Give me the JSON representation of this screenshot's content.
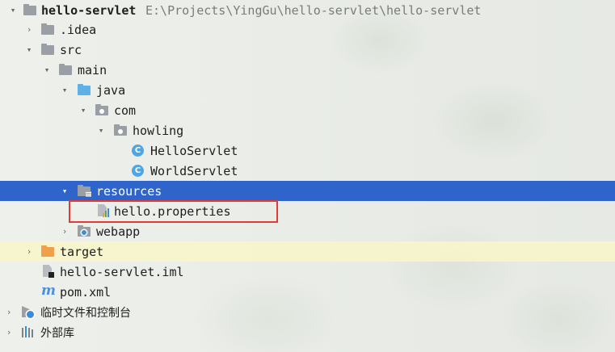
{
  "project_tree": {
    "root": {
      "name": "hello-servlet",
      "path": "E:\\Projects\\YingGu\\hello-servlet\\hello-servlet",
      "icon": "folder-icon"
    },
    "items": [
      {
        "label": ".idea",
        "icon": "folder-icon",
        "expanded": false
      },
      {
        "label": "src",
        "icon": "folder-icon",
        "expanded": true
      },
      {
        "label": "main",
        "icon": "folder-icon",
        "expanded": true
      },
      {
        "label": "java",
        "icon": "source-folder-icon",
        "expanded": true
      },
      {
        "label": "com",
        "icon": "package-icon",
        "expanded": true
      },
      {
        "label": "howling",
        "icon": "package-icon",
        "expanded": true
      },
      {
        "label": "HelloServlet",
        "icon": "class-icon"
      },
      {
        "label": "WorldServlet",
        "icon": "class-icon"
      },
      {
        "label": "resources",
        "icon": "resources-folder-icon",
        "expanded": true,
        "selected": true
      },
      {
        "label": "hello.properties",
        "icon": "properties-file-icon",
        "highlighted": true
      },
      {
        "label": "webapp",
        "icon": "web-folder-icon",
        "expanded": false
      },
      {
        "label": "target",
        "icon": "excluded-folder-icon",
        "expanded": false
      },
      {
        "label": "hello-servlet.iml",
        "icon": "iml-file-icon"
      },
      {
        "label": "pom.xml",
        "icon": "maven-icon"
      },
      {
        "label": "临时文件和控制台",
        "icon": "scratches-icon",
        "expanded": false
      },
      {
        "label": "外部库",
        "icon": "libraries-icon",
        "expanded": false
      }
    ]
  },
  "colors": {
    "selection": "#2f65ca",
    "highlight_box": "#e53935",
    "caret_line": "#f8f6c8"
  }
}
